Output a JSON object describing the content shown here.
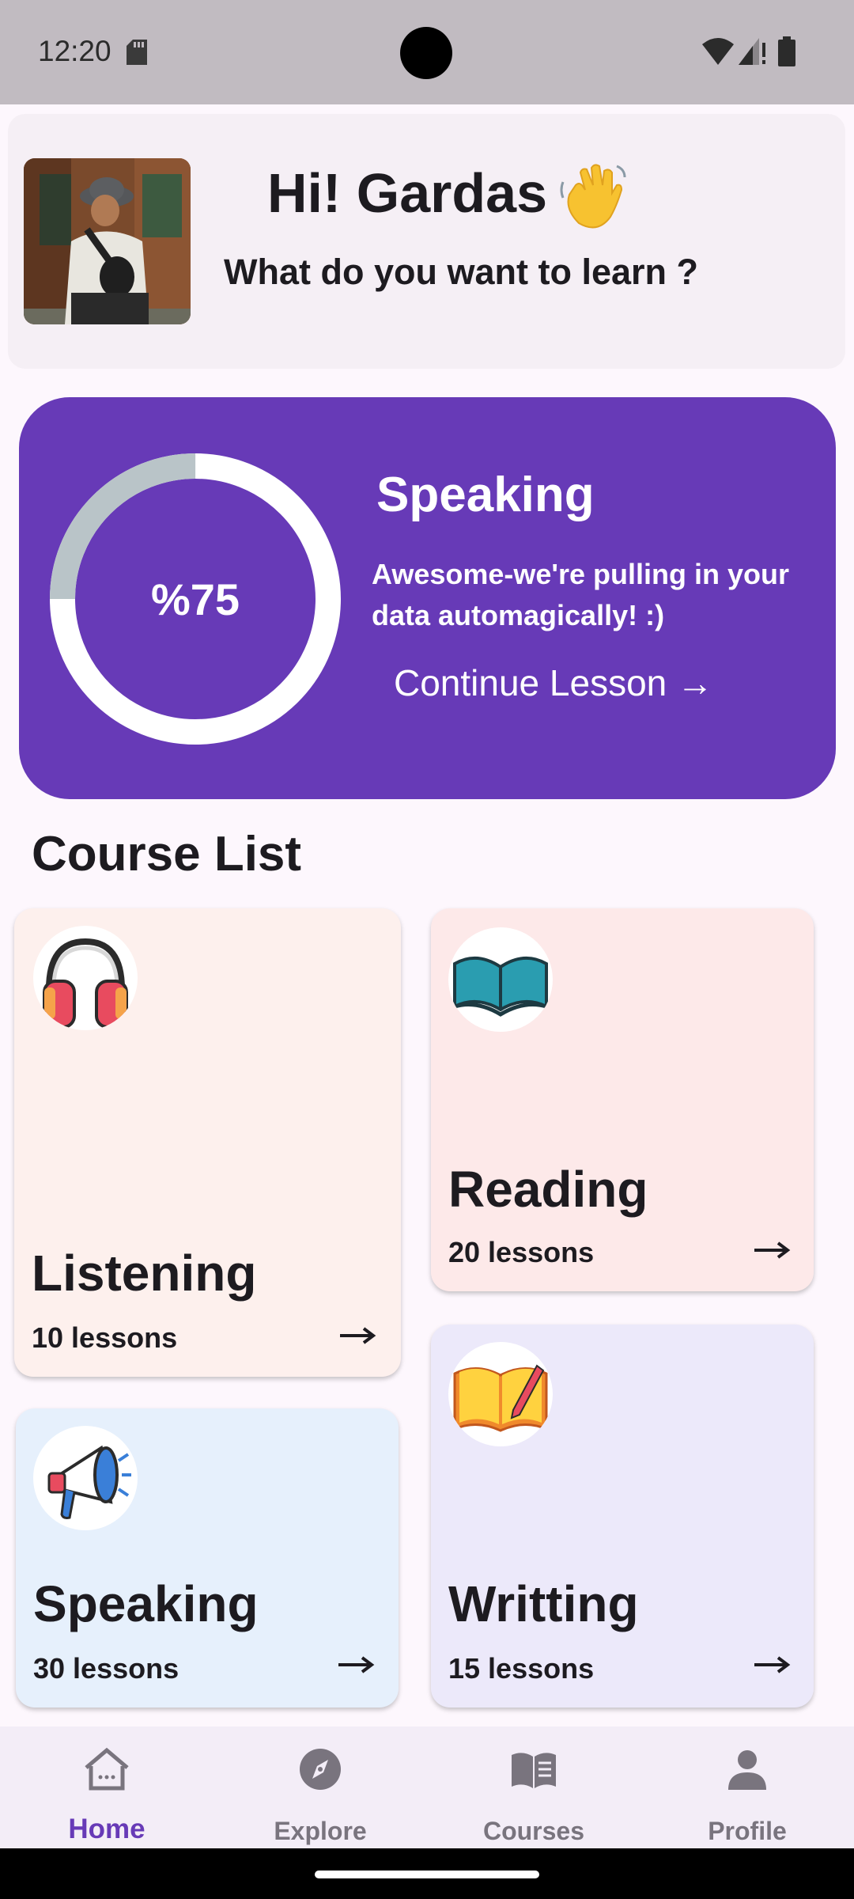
{
  "status_bar": {
    "time": "12:20"
  },
  "header": {
    "greeting": "Hi! Gardas",
    "subtitle": "What do you want to learn ?"
  },
  "progress_card": {
    "progress_fraction": 0.75,
    "progress_label": "%75",
    "title": "Speaking",
    "description": "Awesome-we're pulling in your data automagically! :)",
    "continue_label": "Continue Lesson →"
  },
  "course_list": {
    "title": "Course List",
    "items": [
      {
        "name": "Listening",
        "lessons": "10 lessons",
        "icon": "headphones-icon",
        "color": "#fdf0ed"
      },
      {
        "name": "Reading",
        "lessons": "20 lessons",
        "icon": "open-book-icon",
        "color": "#fde9e9"
      },
      {
        "name": "Speaking",
        "lessons": "30 lessons",
        "icon": "megaphone-icon",
        "color": "#e6f0fc"
      },
      {
        "name": "Writting",
        "lessons": "15 lessons",
        "icon": "writing-book-icon",
        "color": "#ece9fa"
      }
    ]
  },
  "bottom_nav": {
    "items": [
      {
        "label": "Home",
        "icon": "home-icon",
        "active": true
      },
      {
        "label": "Explore",
        "icon": "compass-icon",
        "active": false
      },
      {
        "label": "Courses",
        "icon": "book-icon",
        "active": false
      },
      {
        "label": "Profile",
        "icon": "person-icon",
        "active": false
      }
    ]
  },
  "colors": {
    "accent": "#673ab7",
    "ring_track": "#b9c4c8",
    "nav_inactive": "#79747e"
  }
}
